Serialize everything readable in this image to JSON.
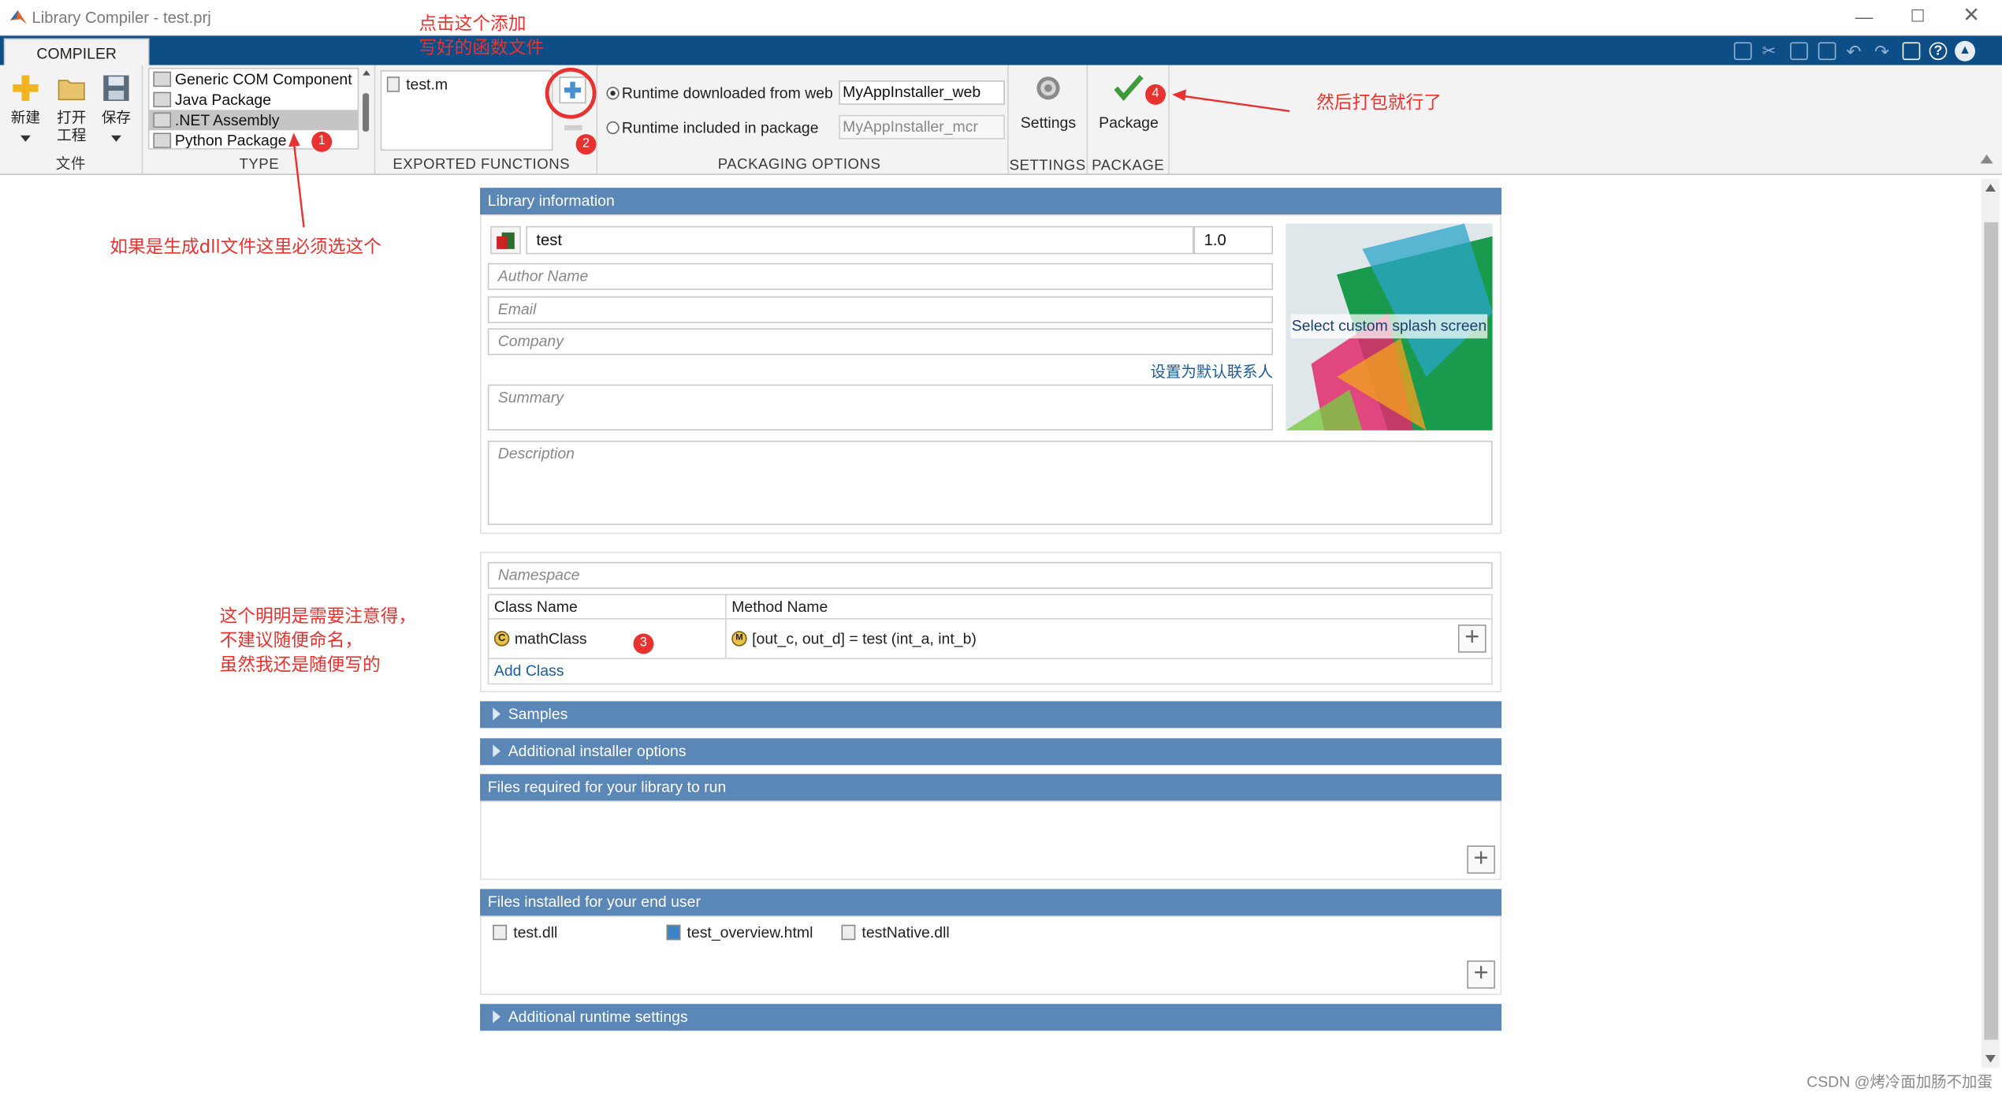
{
  "window": {
    "title": "Library Compiler - test.prj"
  },
  "ribbon": {
    "tab": "COMPILER",
    "file_section": {
      "label": "文件",
      "new": "新建",
      "open": "打开\n工程",
      "save": "保存"
    },
    "type_section": {
      "label": "TYPE",
      "items": [
        "Generic COM Component",
        "Java Package",
        ".NET Assembly",
        "Python Package"
      ],
      "selected": ".NET Assembly"
    },
    "exported_section": {
      "label": "EXPORTED FUNCTIONS",
      "files": [
        "test.m"
      ]
    },
    "packaging_section": {
      "label": "PACKAGING OPTIONS",
      "option_web": "Runtime downloaded from web",
      "option_web_value": "MyAppInstaller_web",
      "option_pkg": "Runtime included in package",
      "option_pkg_value": "MyAppInstaller_mcr"
    },
    "settings_section": {
      "label": "SETTINGS",
      "button": "Settings"
    },
    "package_section": {
      "label": "PACKAGE",
      "button": "Package"
    }
  },
  "library_info": {
    "header": "Library information",
    "name": "test",
    "version": "1.0",
    "author_placeholder": "Author Name",
    "email_placeholder": "Email",
    "company_placeholder": "Company",
    "default_contact_link": "设置为默认联系人",
    "summary_placeholder": "Summary",
    "description_placeholder": "Description",
    "splash_label": "Select custom splash screen"
  },
  "class_section": {
    "namespace_placeholder": "Namespace",
    "col_class": "Class Name",
    "col_method": "Method Name",
    "class_name": "mathClass",
    "method": "[out_c, out_d] = test (int_a, int_b)",
    "add_class": "Add Class"
  },
  "sections": {
    "samples": "Samples",
    "installer_options": "Additional installer options",
    "files_required": "Files required for your library to run",
    "files_installed": "Files installed for your end user",
    "runtime_settings": "Additional runtime settings"
  },
  "installed_files": [
    "test.dll",
    "test_overview.html",
    "testNative.dll"
  ],
  "annotations": {
    "add_function": "点击这个添加\n写好的函数文件",
    "package": "然后打包就行了",
    "dll_note": "如果是生成dll文件这里必须选这个",
    "class_note": "这个明明是需要注意得，\n不建议随便命名，\n虽然我还是随便写的",
    "badges": [
      "1",
      "2",
      "3",
      "4"
    ]
  },
  "watermark": "CSDN @烤冷面加肠不加蛋",
  "colors": {
    "titlebar_tab": "#0d4e87",
    "section_bar": "#5b87b7",
    "annotation": "#e8322f"
  }
}
